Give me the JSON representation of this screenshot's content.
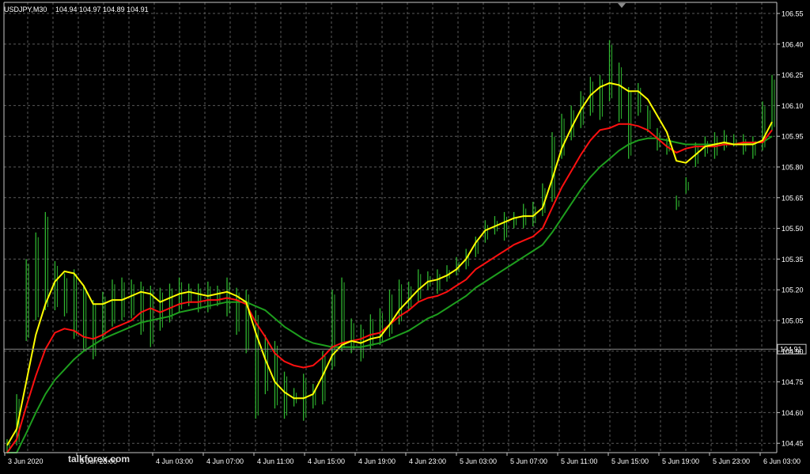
{
  "window": {
    "symbol_label": "USDJPY,M30",
    "ohlc_label": "104.94 104.97 104.89 104.91"
  },
  "watermark": "talkforex.com",
  "colors": {
    "background": "#000000",
    "grid": "#5a5a5a",
    "axis": "#c8c8c8",
    "text": "#ffffff",
    "bars": "#2fb52f",
    "ma_fast": "#ffff00",
    "ma_mid": "#ff1010",
    "ma_slow": "#1e9e1e",
    "price_line": "#8a8a8a"
  },
  "chart_data": {
    "type": "line",
    "title": "USDJPY,M30",
    "ylim": [
      104.38,
      106.62
    ],
    "y_ticks": [
      "106.55",
      "106.40",
      "106.25",
      "106.10",
      "105.95",
      "105.80",
      "105.65",
      "105.50",
      "105.35",
      "105.20",
      "105.05",
      "104.90",
      "104.75",
      "104.60",
      "104.45"
    ],
    "x_ticks": [
      "3 Jun 2020",
      "3 Jun 23:00",
      "4 Jun 03:00",
      "4 Jun 07:00",
      "4 Jun 11:00",
      "4 Jun 15:00",
      "4 Jun 19:00",
      "4 Jun 23:00",
      "5 Jun 03:00",
      "5 Jun 07:00",
      "5 Jun 11:00",
      "5 Jun 15:00",
      "5 Jun 19:00",
      "5 Jun 23:00",
      "6 Jun 03:00"
    ],
    "current_price": "104.91",
    "grid": true,
    "series": [
      {
        "role": "ma_fast",
        "values": [
          104.44,
          104.52,
          104.75,
          104.98,
          105.13,
          105.24,
          105.29,
          105.28,
          105.22,
          105.13,
          105.13,
          105.15,
          105.15,
          105.17,
          105.19,
          105.18,
          105.14,
          105.16,
          105.18,
          105.19,
          105.18,
          105.17,
          105.18,
          105.19,
          105.17,
          105.14,
          104.99,
          104.86,
          104.75,
          104.7,
          104.67,
          104.67,
          104.69,
          104.78,
          104.88,
          104.93,
          104.95,
          104.94,
          104.96,
          104.97,
          105.03,
          105.1,
          105.15,
          105.2,
          105.24,
          105.25,
          105.27,
          105.3,
          105.35,
          105.43,
          105.49,
          105.51,
          105.53,
          105.55,
          105.56,
          105.56,
          105.6,
          105.74,
          105.89,
          105.99,
          106.08,
          106.15,
          106.19,
          106.21,
          106.2,
          106.17,
          106.17,
          106.13,
          106.05,
          105.97,
          105.83,
          105.82,
          105.86,
          105.9,
          105.91,
          105.92,
          105.91,
          105.91,
          105.91,
          105.93,
          106.02
        ]
      },
      {
        "role": "ma_mid",
        "values": [
          104.38,
          104.47,
          104.63,
          104.78,
          104.91,
          104.99,
          105.01,
          105.0,
          104.97,
          104.96,
          104.98,
          105.01,
          105.03,
          105.05,
          105.09,
          105.11,
          105.09,
          105.11,
          105.13,
          105.14,
          105.14,
          105.15,
          105.15,
          105.16,
          105.15,
          105.13,
          105.04,
          104.97,
          104.89,
          104.85,
          104.83,
          104.82,
          104.83,
          104.87,
          104.92,
          104.94,
          104.95,
          104.96,
          104.98,
          104.99,
          105.03,
          105.07,
          105.1,
          105.14,
          105.16,
          105.17,
          105.19,
          105.22,
          105.25,
          105.3,
          105.33,
          105.36,
          105.39,
          105.42,
          105.44,
          105.46,
          105.5,
          105.6,
          105.7,
          105.78,
          105.86,
          105.93,
          105.98,
          105.99,
          106.01,
          106.01,
          106.0,
          105.98,
          105.94,
          105.9,
          105.87,
          105.89,
          105.9,
          105.9,
          105.9,
          105.91,
          105.91,
          105.92,
          105.92,
          105.92,
          105.98
        ]
      },
      {
        "role": "ma_slow",
        "values": [
          104.3,
          104.39,
          104.5,
          104.6,
          104.69,
          104.76,
          104.81,
          104.86,
          104.9,
          104.93,
          104.96,
          104.98,
          105.0,
          105.02,
          105.04,
          105.05,
          105.06,
          105.07,
          105.09,
          105.1,
          105.11,
          105.12,
          105.13,
          105.14,
          105.14,
          105.14,
          105.12,
          105.1,
          105.06,
          105.02,
          104.99,
          104.96,
          104.94,
          104.93,
          104.92,
          104.92,
          104.92,
          104.92,
          104.93,
          104.94,
          104.96,
          104.98,
          105.0,
          105.03,
          105.06,
          105.08,
          105.11,
          105.14,
          105.17,
          105.21,
          105.24,
          105.27,
          105.3,
          105.33,
          105.36,
          105.39,
          105.42,
          105.48,
          105.55,
          105.62,
          105.69,
          105.75,
          105.8,
          105.84,
          105.88,
          105.91,
          105.93,
          105.94,
          105.94,
          105.93,
          105.92,
          105.91,
          105.91,
          105.91,
          105.91,
          105.92,
          105.91,
          105.91,
          105.92,
          105.92,
          105.95
        ]
      }
    ],
    "bars": [
      [
        104.47,
        104.4
      ],
      [
        104.69,
        104.44
      ],
      [
        105.35,
        104.95
      ],
      [
        105.48,
        105.05
      ],
      [
        105.58,
        105.1
      ],
      [
        105.34,
        105.1
      ],
      [
        105.28,
        105.07
      ],
      [
        105.3,
        104.96
      ],
      [
        105.22,
        104.9
      ],
      [
        105.15,
        104.86
      ],
      [
        105.19,
        104.96
      ],
      [
        105.25,
        105.02
      ],
      [
        105.26,
        105.05
      ],
      [
        105.25,
        105.06
      ],
      [
        105.24,
        104.98
      ],
      [
        105.22,
        104.92
      ],
      [
        105.21,
        105.0
      ],
      [
        105.23,
        105.04
      ],
      [
        105.26,
        105.09
      ],
      [
        105.23,
        105.12
      ],
      [
        105.23,
        105.09
      ],
      [
        105.24,
        105.09
      ],
      [
        105.22,
        105.12
      ],
      [
        105.26,
        105.07
      ],
      [
        105.21,
        104.98
      ],
      [
        105.2,
        104.89
      ],
      [
        105.1,
        104.57
      ],
      [
        104.98,
        104.69
      ],
      [
        104.95,
        104.62
      ],
      [
        104.8,
        104.57
      ],
      [
        104.72,
        104.63
      ],
      [
        104.79,
        104.56
      ],
      [
        104.74,
        104.62
      ],
      [
        104.9,
        104.64
      ],
      [
        105.2,
        104.81
      ],
      [
        105.26,
        104.9
      ],
      [
        105.06,
        104.89
      ],
      [
        105.03,
        104.85
      ],
      [
        105.08,
        104.91
      ],
      [
        105.11,
        104.93
      ],
      [
        105.2,
        104.97
      ],
      [
        105.25,
        105.03
      ],
      [
        105.24,
        105.1
      ],
      [
        105.3,
        105.14
      ],
      [
        105.29,
        105.2
      ],
      [
        105.3,
        105.18
      ],
      [
        105.32,
        105.24
      ],
      [
        105.36,
        105.27
      ],
      [
        105.4,
        105.3
      ],
      [
        105.46,
        105.36
      ],
      [
        105.54,
        105.43
      ],
      [
        105.56,
        105.47
      ],
      [
        105.58,
        105.44
      ],
      [
        105.58,
        105.5
      ],
      [
        105.62,
        105.5
      ],
      [
        105.63,
        105.51
      ],
      [
        105.72,
        105.56
      ],
      [
        105.97,
        105.63
      ],
      [
        106.06,
        105.84
      ],
      [
        106.1,
        105.93
      ],
      [
        106.17,
        105.99
      ],
      [
        106.24,
        106.05
      ],
      [
        106.25,
        106.03
      ],
      [
        106.42,
        106.12
      ],
      [
        106.31,
        106.02
      ],
      [
        106.19,
        105.84
      ],
      [
        106.21,
        106.05
      ],
      [
        106.1,
        105.97
      ],
      [
        105.99,
        105.88
      ],
      [
        105.94,
        105.86
      ],
      [
        105.66,
        105.59
      ],
      [
        105.75,
        105.67
      ],
      [
        105.92,
        105.8
      ],
      [
        105.95,
        105.85
      ],
      [
        105.97,
        105.84
      ],
      [
        105.98,
        105.88
      ],
      [
        105.96,
        105.9
      ],
      [
        105.96,
        105.86
      ],
      [
        105.95,
        105.84
      ],
      [
        106.12,
        105.88
      ],
      [
        106.25,
        105.98
      ]
    ]
  }
}
